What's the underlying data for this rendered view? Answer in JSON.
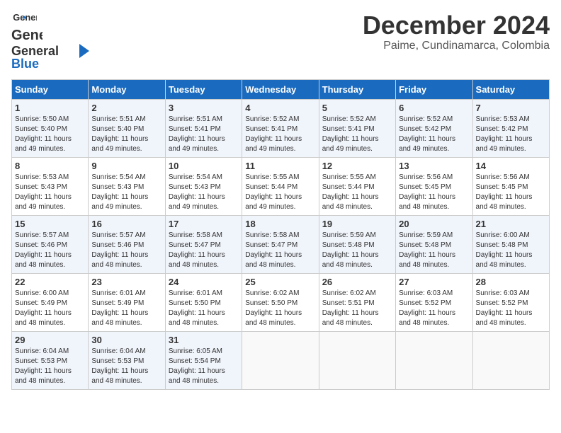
{
  "header": {
    "logo_general": "General",
    "logo_blue": "Blue",
    "title": "December 2024",
    "subtitle": "Paime, Cundinamarca, Colombia"
  },
  "weekdays": [
    "Sunday",
    "Monday",
    "Tuesday",
    "Wednesday",
    "Thursday",
    "Friday",
    "Saturday"
  ],
  "weeks": [
    [
      {
        "day": "1",
        "sunrise": "5:50 AM",
        "sunset": "5:40 PM",
        "daylight": "11 hours and 49 minutes."
      },
      {
        "day": "2",
        "sunrise": "5:51 AM",
        "sunset": "5:40 PM",
        "daylight": "11 hours and 49 minutes."
      },
      {
        "day": "3",
        "sunrise": "5:51 AM",
        "sunset": "5:41 PM",
        "daylight": "11 hours and 49 minutes."
      },
      {
        "day": "4",
        "sunrise": "5:52 AM",
        "sunset": "5:41 PM",
        "daylight": "11 hours and 49 minutes."
      },
      {
        "day": "5",
        "sunrise": "5:52 AM",
        "sunset": "5:41 PM",
        "daylight": "11 hours and 49 minutes."
      },
      {
        "day": "6",
        "sunrise": "5:52 AM",
        "sunset": "5:42 PM",
        "daylight": "11 hours and 49 minutes."
      },
      {
        "day": "7",
        "sunrise": "5:53 AM",
        "sunset": "5:42 PM",
        "daylight": "11 hours and 49 minutes."
      }
    ],
    [
      {
        "day": "8",
        "sunrise": "5:53 AM",
        "sunset": "5:43 PM",
        "daylight": "11 hours and 49 minutes."
      },
      {
        "day": "9",
        "sunrise": "5:54 AM",
        "sunset": "5:43 PM",
        "daylight": "11 hours and 49 minutes."
      },
      {
        "day": "10",
        "sunrise": "5:54 AM",
        "sunset": "5:43 PM",
        "daylight": "11 hours and 49 minutes."
      },
      {
        "day": "11",
        "sunrise": "5:55 AM",
        "sunset": "5:44 PM",
        "daylight": "11 hours and 49 minutes."
      },
      {
        "day": "12",
        "sunrise": "5:55 AM",
        "sunset": "5:44 PM",
        "daylight": "11 hours and 48 minutes."
      },
      {
        "day": "13",
        "sunrise": "5:56 AM",
        "sunset": "5:45 PM",
        "daylight": "11 hours and 48 minutes."
      },
      {
        "day": "14",
        "sunrise": "5:56 AM",
        "sunset": "5:45 PM",
        "daylight": "11 hours and 48 minutes."
      }
    ],
    [
      {
        "day": "15",
        "sunrise": "5:57 AM",
        "sunset": "5:46 PM",
        "daylight": "11 hours and 48 minutes."
      },
      {
        "day": "16",
        "sunrise": "5:57 AM",
        "sunset": "5:46 PM",
        "daylight": "11 hours and 48 minutes."
      },
      {
        "day": "17",
        "sunrise": "5:58 AM",
        "sunset": "5:47 PM",
        "daylight": "11 hours and 48 minutes."
      },
      {
        "day": "18",
        "sunrise": "5:58 AM",
        "sunset": "5:47 PM",
        "daylight": "11 hours and 48 minutes."
      },
      {
        "day": "19",
        "sunrise": "5:59 AM",
        "sunset": "5:48 PM",
        "daylight": "11 hours and 48 minutes."
      },
      {
        "day": "20",
        "sunrise": "5:59 AM",
        "sunset": "5:48 PM",
        "daylight": "11 hours and 48 minutes."
      },
      {
        "day": "21",
        "sunrise": "6:00 AM",
        "sunset": "5:48 PM",
        "daylight": "11 hours and 48 minutes."
      }
    ],
    [
      {
        "day": "22",
        "sunrise": "6:00 AM",
        "sunset": "5:49 PM",
        "daylight": "11 hours and 48 minutes."
      },
      {
        "day": "23",
        "sunrise": "6:01 AM",
        "sunset": "5:49 PM",
        "daylight": "11 hours and 48 minutes."
      },
      {
        "day": "24",
        "sunrise": "6:01 AM",
        "sunset": "5:50 PM",
        "daylight": "11 hours and 48 minutes."
      },
      {
        "day": "25",
        "sunrise": "6:02 AM",
        "sunset": "5:50 PM",
        "daylight": "11 hours and 48 minutes."
      },
      {
        "day": "26",
        "sunrise": "6:02 AM",
        "sunset": "5:51 PM",
        "daylight": "11 hours and 48 minutes."
      },
      {
        "day": "27",
        "sunrise": "6:03 AM",
        "sunset": "5:52 PM",
        "daylight": "11 hours and 48 minutes."
      },
      {
        "day": "28",
        "sunrise": "6:03 AM",
        "sunset": "5:52 PM",
        "daylight": "11 hours and 48 minutes."
      }
    ],
    [
      {
        "day": "29",
        "sunrise": "6:04 AM",
        "sunset": "5:53 PM",
        "daylight": "11 hours and 48 minutes."
      },
      {
        "day": "30",
        "sunrise": "6:04 AM",
        "sunset": "5:53 PM",
        "daylight": "11 hours and 48 minutes."
      },
      {
        "day": "31",
        "sunrise": "6:05 AM",
        "sunset": "5:54 PM",
        "daylight": "11 hours and 48 minutes."
      },
      null,
      null,
      null,
      null
    ]
  ],
  "labels": {
    "sunrise": "Sunrise:",
    "sunset": "Sunset:",
    "daylight": "Daylight:"
  }
}
